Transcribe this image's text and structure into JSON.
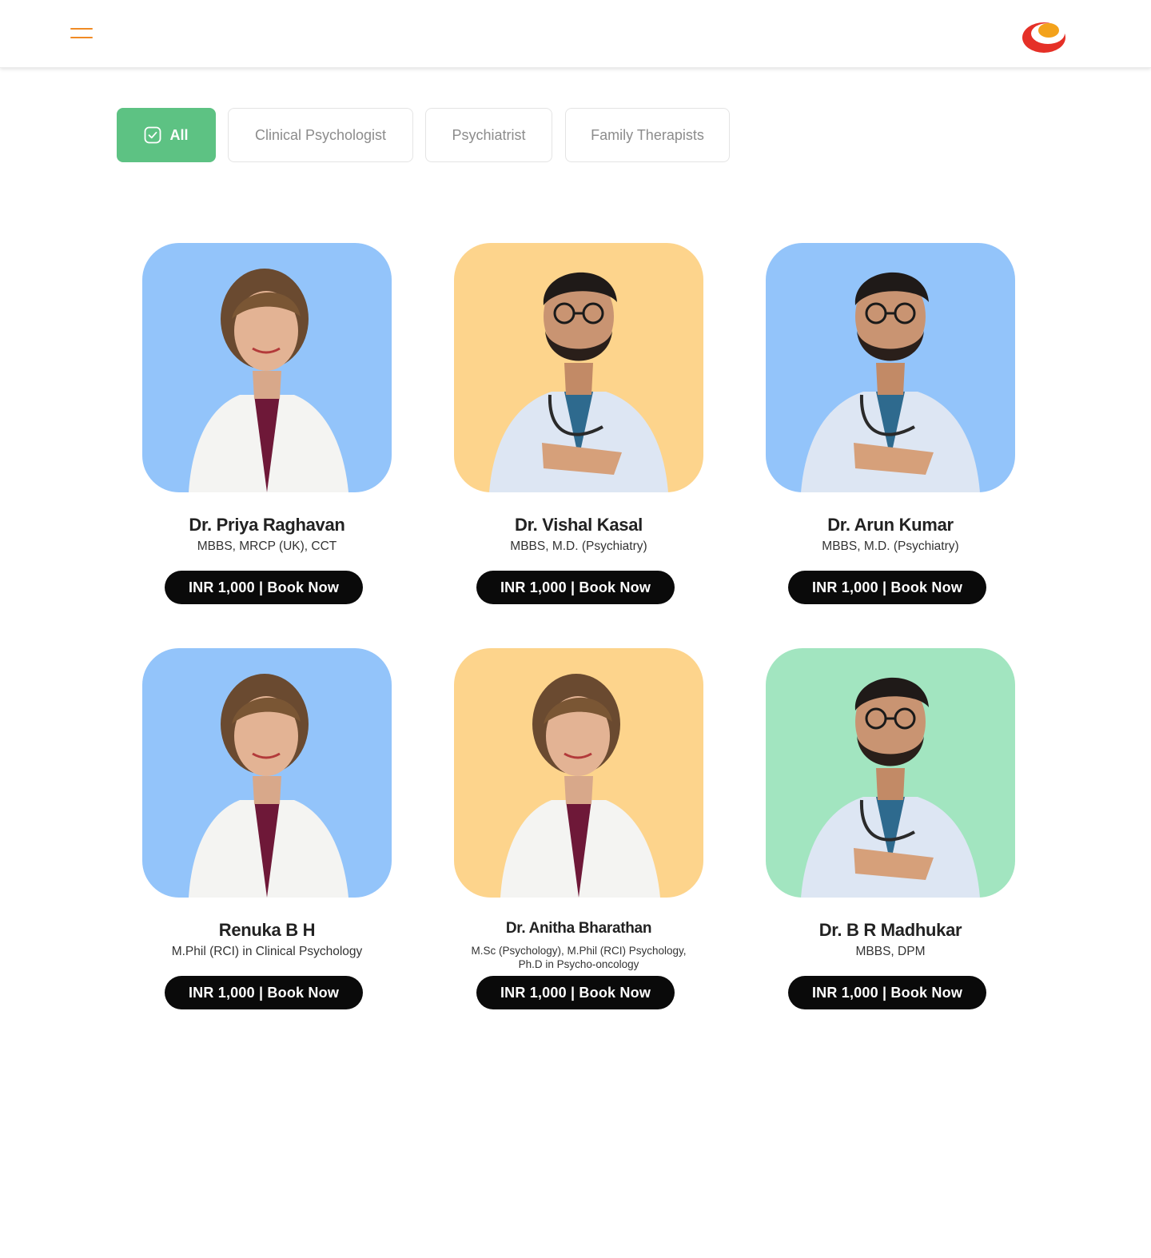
{
  "header": {
    "menu_icon": "hamburger-menu-icon",
    "logo_icon": "brand-logo",
    "colors": {
      "menu": "#f08a24",
      "logo_primary": "#e53027",
      "logo_accent": "#f3a21b"
    }
  },
  "filters": [
    {
      "label": "All",
      "active": true,
      "icon": "checkbox-check-icon"
    },
    {
      "label": "Clinical Psychologist",
      "active": false
    },
    {
      "label": "Psychiatrist",
      "active": false
    },
    {
      "label": "Family Therapists",
      "active": false
    }
  ],
  "colors": {
    "active_filter": "#5dc283",
    "card_blue": "#93c4fa",
    "card_yellow": "#fdd48c",
    "card_green": "#a2e5c0",
    "button": "#0a0a0a"
  },
  "doctors": [
    {
      "name": "Dr. Priya Raghavan",
      "qualifications": "MBBS, MRCP (UK), CCT",
      "cta": "INR 1,000 | Book Now",
      "bg": "blue",
      "photo": "female-doctor-photo"
    },
    {
      "name": "Dr. Vishal Kasal",
      "qualifications": "MBBS, M.D. (Psychiatry)",
      "cta": "INR 1,000 | Book Now",
      "bg": "yellow",
      "photo": "male-doctor-photo"
    },
    {
      "name": "Dr. Arun Kumar",
      "qualifications": "MBBS, M.D. (Psychiatry)",
      "cta": "INR 1,000 | Book Now",
      "bg": "blue",
      "photo": "male-doctor-photo"
    },
    {
      "name": "Renuka B H",
      "qualifications": "M.Phil (RCI) in Clinical Psychology",
      "cta": "INR 1,000 | Book Now",
      "bg": "blue",
      "photo": "female-doctor-photo"
    },
    {
      "name": "Dr. Anitha Bharathan",
      "qualifications": "M.Sc (Psychology), M.Phil (RCI) Psychology, Ph.D in Psycho-oncology",
      "cta": "INR 1,000 | Book Now",
      "bg": "yellow",
      "photo": "female-doctor-photo"
    },
    {
      "name": "Dr. B R Madhukar",
      "qualifications": "MBBS, DPM",
      "cta": "INR 1,000 | Book Now",
      "bg": "green",
      "photo": "male-doctor-photo"
    }
  ]
}
